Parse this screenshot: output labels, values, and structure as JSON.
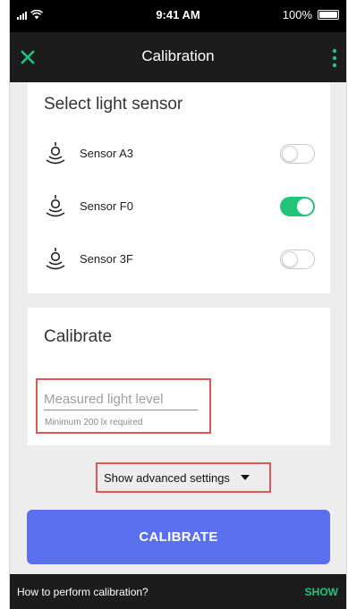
{
  "status_bar": {
    "time": "9:41 AM",
    "battery": "100%"
  },
  "app_bar": {
    "title": "Calibration"
  },
  "sensor_section": {
    "heading": "Select light sensor",
    "sensors": [
      {
        "label": "Sensor A3",
        "enabled": false
      },
      {
        "label": "Sensor F0",
        "enabled": true
      },
      {
        "label": "Sensor 3F",
        "enabled": false
      }
    ]
  },
  "calibrate_section": {
    "heading": "Calibrate",
    "light_input": {
      "value": "",
      "placeholder": "Measured light level",
      "helper": "Minimum 200 lx required"
    }
  },
  "advanced": {
    "label": "Show advanced settings"
  },
  "calibrate_button": {
    "label": "CALIBRATE"
  },
  "snackbar": {
    "message": "How to perform calibration?",
    "action": "SHOW"
  },
  "colors": {
    "accent_green": "#22c47a",
    "button_blue": "#5a70ee",
    "highlight_red": "#e05555",
    "bar_dark": "#1c1c1c"
  }
}
